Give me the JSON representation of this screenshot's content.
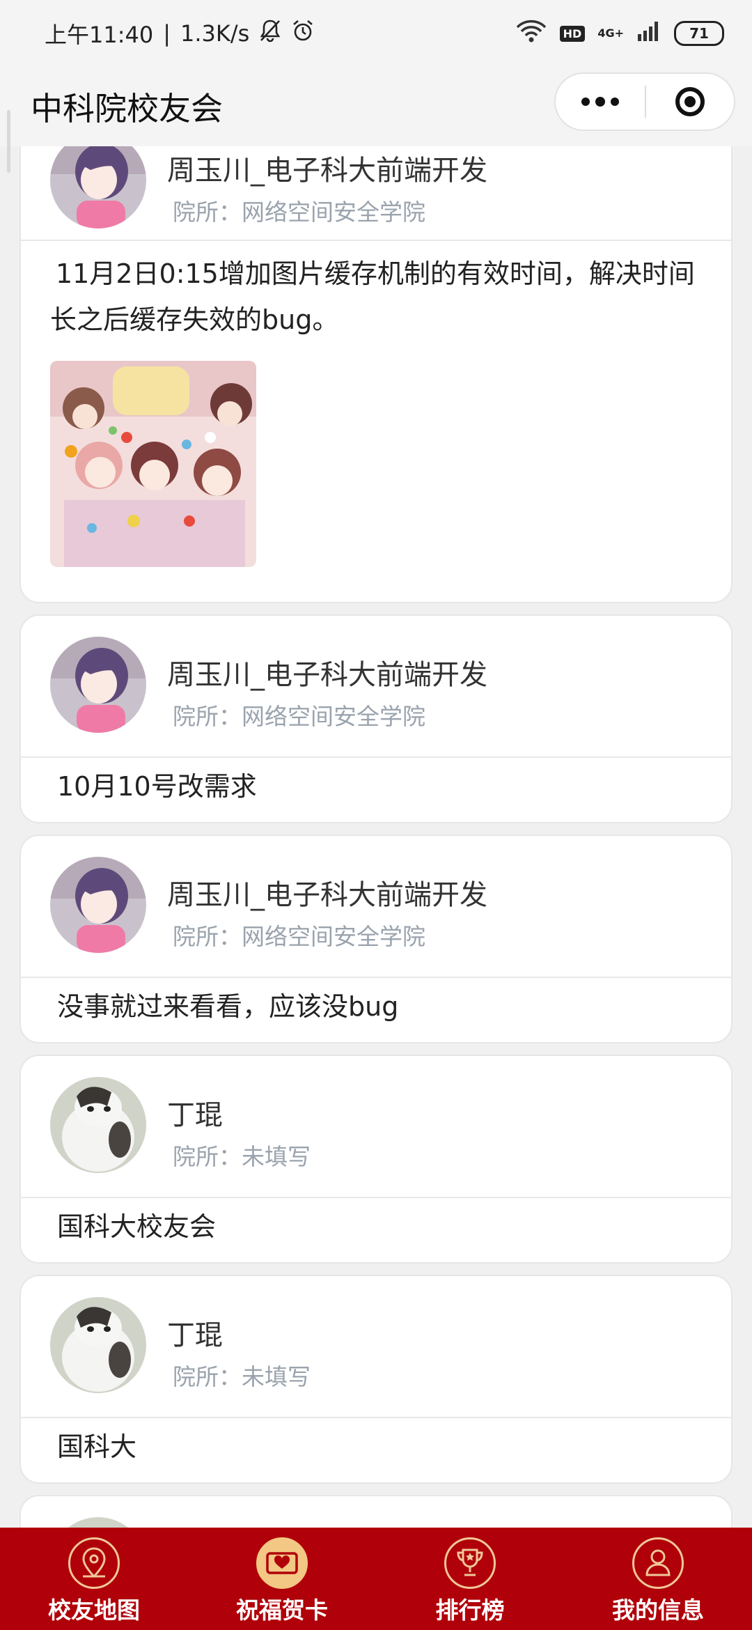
{
  "status_bar": {
    "time": "上午11:40",
    "speed": "1.3K/s",
    "network": "4G+",
    "battery": "71"
  },
  "nav": {
    "title": "中科院校友会"
  },
  "posts": [
    {
      "name": "周玉川_电子科大前端开发",
      "institute": "院所：网络空间安全学院",
      "content": "11月2日0:15增加图片缓存机制的有效时间，解决时间长之后缓存失效的bug。",
      "has_image": true
    },
    {
      "name": "周玉川_电子科大前端开发",
      "institute": "院所：网络空间安全学院",
      "content": "10月10号改需求"
    },
    {
      "name": "周玉川_电子科大前端开发",
      "institute": "院所：网络空间安全学院",
      "content": "没事就过来看看，应该没bug"
    },
    {
      "name": "丁琨",
      "institute": "院所：未填写",
      "content": "国科大校友会"
    },
    {
      "name": "丁琨",
      "institute": "院所：未填写",
      "content": "国科大"
    }
  ],
  "tabs": [
    {
      "label": "校友地图",
      "icon": "map-pin-icon"
    },
    {
      "label": "祝福贺卡",
      "icon": "greeting-card-icon",
      "active": true
    },
    {
      "label": "排行榜",
      "icon": "trophy-icon"
    },
    {
      "label": "我的信息",
      "icon": "user-icon"
    }
  ],
  "colors": {
    "tab_bar": "#b00009",
    "accent": "#f3c784",
    "secondary_text": "#9aa3ad"
  }
}
